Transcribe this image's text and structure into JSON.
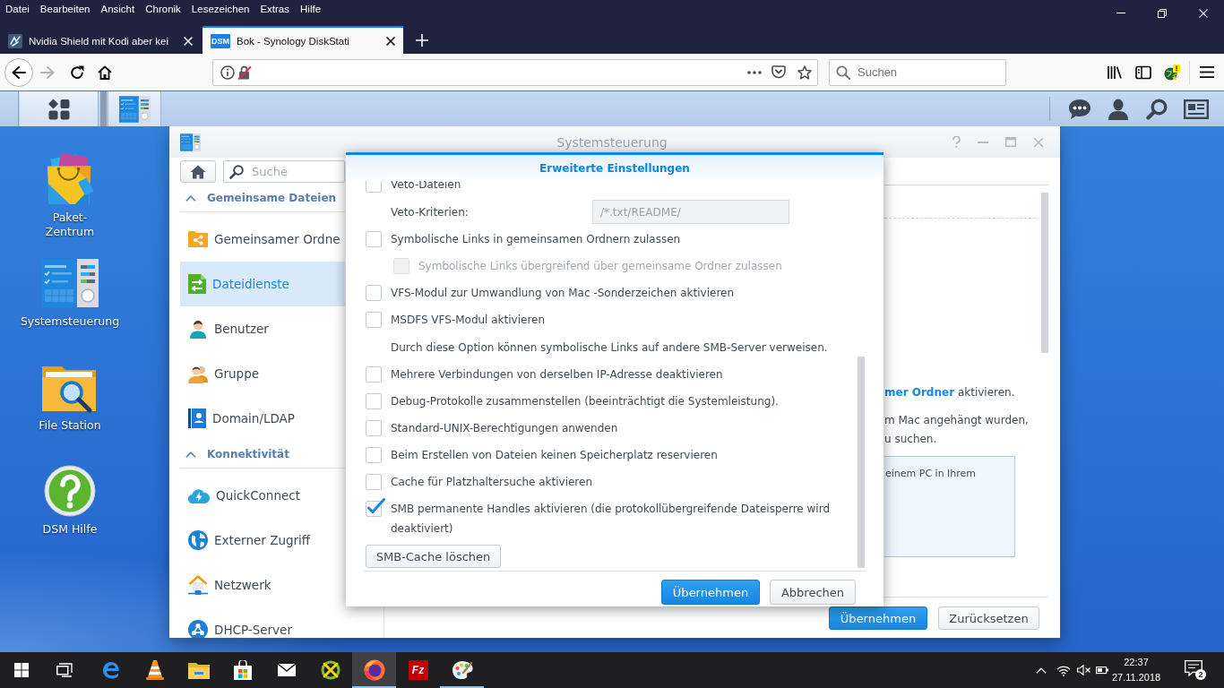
{
  "browser": {
    "menu": [
      "Datei",
      "Bearbeiten",
      "Ansicht",
      "Chronik",
      "Lesezeichen",
      "Extras",
      "Hilfe"
    ],
    "tabs": [
      {
        "title": "Nvidia Shield mit Kodi aber kei",
        "kind": "page",
        "selected": false
      },
      {
        "title": "Bok - Synology DiskStati",
        "kind": "dsm",
        "favicon_text": "DSM",
        "selected": true
      }
    ],
    "search": {
      "placeholder": "Suchen"
    }
  },
  "desktop_icons": [
    {
      "label": "Paket-Zentrum",
      "kind": "package"
    },
    {
      "label": "Systemsteuerung",
      "kind": "control_panel"
    },
    {
      "label": "File Station",
      "kind": "file_station"
    },
    {
      "label": "DSM Hilfe",
      "kind": "help"
    }
  ],
  "window": {
    "title": "Systemsteuerung",
    "search": {
      "placeholder": "Suche"
    },
    "sidebar": [
      {
        "heading": "Gemeinsame Dateien",
        "expanded": true,
        "items": [
          {
            "label": "Gemeinsamer Ordne",
            "kind": "shared_folder",
            "selected": false
          },
          {
            "label": "Dateidienste",
            "kind": "file_services",
            "selected": true
          },
          {
            "label": "Benutzer",
            "kind": "user",
            "selected": false
          },
          {
            "label": "Gruppe",
            "kind": "group",
            "selected": false
          },
          {
            "label": "Domain/LDAP",
            "kind": "domain",
            "selected": false
          }
        ]
      },
      {
        "heading": "Konnektivität",
        "expanded": true,
        "items": [
          {
            "label": "QuickConnect",
            "kind": "cloud",
            "selected": false
          },
          {
            "label": "Externer Zugriff",
            "kind": "globe",
            "selected": false
          },
          {
            "label": "Netzwerk",
            "kind": "network",
            "selected": false
          },
          {
            "label": "DHCP-Server",
            "kind": "dhcp",
            "selected": false
          }
        ]
      }
    ],
    "content": {
      "notice": {
        "link": "mer Ordner",
        "text": "aktivieren."
      },
      "lines": [
        "m Mac angehängt wurden,",
        "u suchen."
      ],
      "info_box": "einem PC in Ihrem"
    },
    "buttons": [
      {
        "label": "Übernehmen",
        "primary": true
      },
      {
        "label": "Zurücksetzen",
        "primary": false
      }
    ]
  },
  "dialog": {
    "title": "Erweiterte Einstellungen",
    "rows": [
      {
        "kind": "checkbox",
        "label": "Veto-Dateien",
        "checked": false,
        "disabled": false
      },
      {
        "kind": "field",
        "label": "Veto-Kriterien:",
        "value": "/*.txt/README/",
        "disabled": true
      },
      {
        "kind": "checkbox",
        "label": "Symbolische Links in gemeinsamen Ordnern zulassen",
        "checked": false,
        "disabled": false,
        "children": [
          {
            "kind": "checkbox",
            "label": "Symbolische Links übergreifend über gemeinsame Ordner zulassen",
            "checked": false,
            "disabled": true
          }
        ]
      },
      {
        "kind": "checkbox",
        "label": "VFS-Modul zur Umwandlung von Mac -Sonderzeichen aktivieren",
        "checked": false,
        "disabled": false
      },
      {
        "kind": "checkbox",
        "label": "MSDFS VFS-Modul aktivieren",
        "checked": false,
        "disabled": false
      },
      {
        "kind": "note",
        "text": "Durch diese Option können symbolische Links auf andere SMB-Server verweisen."
      },
      {
        "kind": "checkbox",
        "label": "Mehrere Verbindungen von derselben IP-Adresse deaktivieren",
        "checked": false,
        "disabled": false
      },
      {
        "kind": "checkbox",
        "label": "Debug-Protokolle zusammenstellen (beeinträchtigt die Systemleistung).",
        "checked": false,
        "disabled": false
      },
      {
        "kind": "checkbox",
        "label": "Standard-UNIX-Berechtigungen anwenden",
        "checked": false,
        "disabled": false
      },
      {
        "kind": "checkbox",
        "label": "Beim Erstellen von Dateien keinen Speicherplatz reservieren",
        "checked": false,
        "disabled": false
      },
      {
        "kind": "checkbox",
        "label": "Cache für Platzhaltersuche aktivieren",
        "checked": false,
        "disabled": false
      },
      {
        "kind": "checkbox",
        "label": "SMB permanente Handles aktivieren (die protokollübergreifende Dateisperre wird deaktiviert)",
        "checked": true,
        "disabled": false
      },
      {
        "kind": "button",
        "label": "SMB-Cache löschen"
      }
    ],
    "buttons": [
      {
        "label": "Übernehmen",
        "primary": true
      },
      {
        "label": "Abbrechen",
        "primary": false
      }
    ]
  },
  "taskbar": {
    "apps": [
      {
        "kind": "edge",
        "running": false,
        "selected": false
      },
      {
        "kind": "vlc",
        "running": false,
        "selected": false
      },
      {
        "kind": "explorer",
        "running": false,
        "selected": false
      },
      {
        "kind": "store",
        "running": false,
        "selected": false
      },
      {
        "kind": "mail",
        "running": false,
        "selected": false
      },
      {
        "kind": "tool",
        "running": false,
        "selected": false
      },
      {
        "kind": "firefox",
        "running": true,
        "selected": true
      },
      {
        "kind": "filezilla",
        "logo_text": "Fz",
        "running": false,
        "selected": false
      },
      {
        "kind": "paint",
        "running": true,
        "selected": false
      }
    ],
    "time": "22:37",
    "date": "27.11.2018",
    "notification_count": "2"
  }
}
